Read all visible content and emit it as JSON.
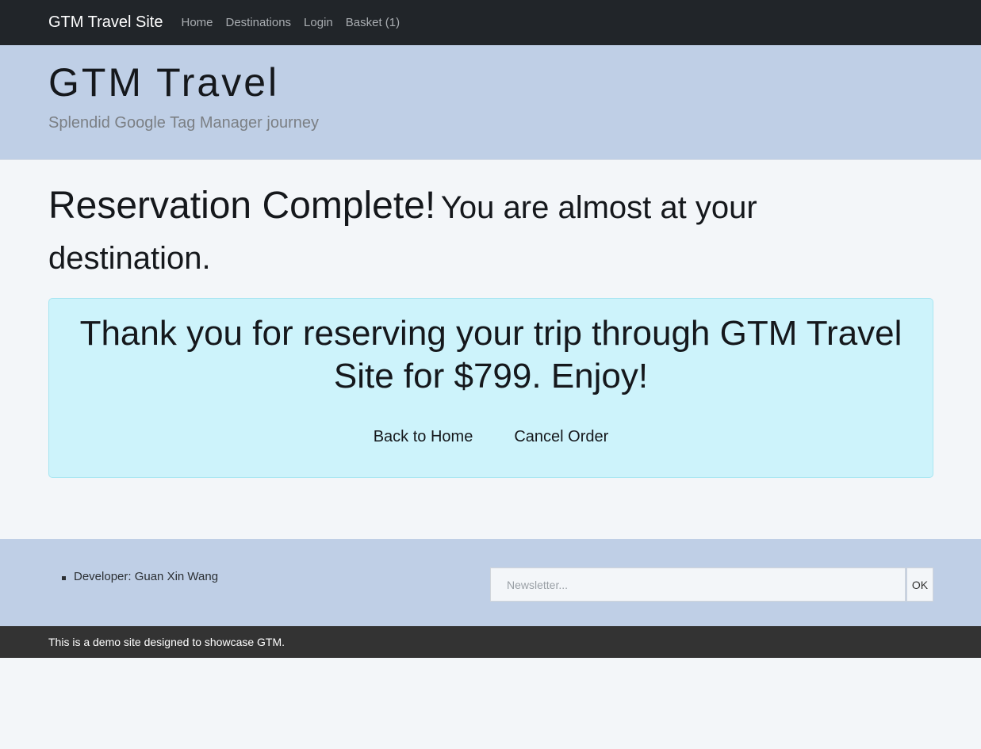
{
  "navbar": {
    "brand": "GTM Travel Site",
    "links": [
      "Home",
      "Destinations",
      "Login",
      "Basket (1)"
    ]
  },
  "hero": {
    "title": "GTM Travel",
    "subtitle": "Splendid Google Tag Manager journey"
  },
  "main": {
    "heading_big": "Reservation Complete!",
    "heading_small": "You are almost at your destination.",
    "alert_text": "Thank you for reserving your trip through GTM Travel Site for $799. Enjoy!",
    "back_home": "Back to Home",
    "cancel_order": "Cancel Order"
  },
  "footer": {
    "developer": "Developer: Guan Xin Wang",
    "newsletter_placeholder": "Newsletter...",
    "ok_label": "OK",
    "bottom_text": "This is a demo site designed to showcase GTM."
  },
  "colors": {
    "navbar_bg": "#212529",
    "hero_bg": "#bfcfe6",
    "alert_bg": "#cdf3fb",
    "bottom_bar_bg": "#333333"
  }
}
